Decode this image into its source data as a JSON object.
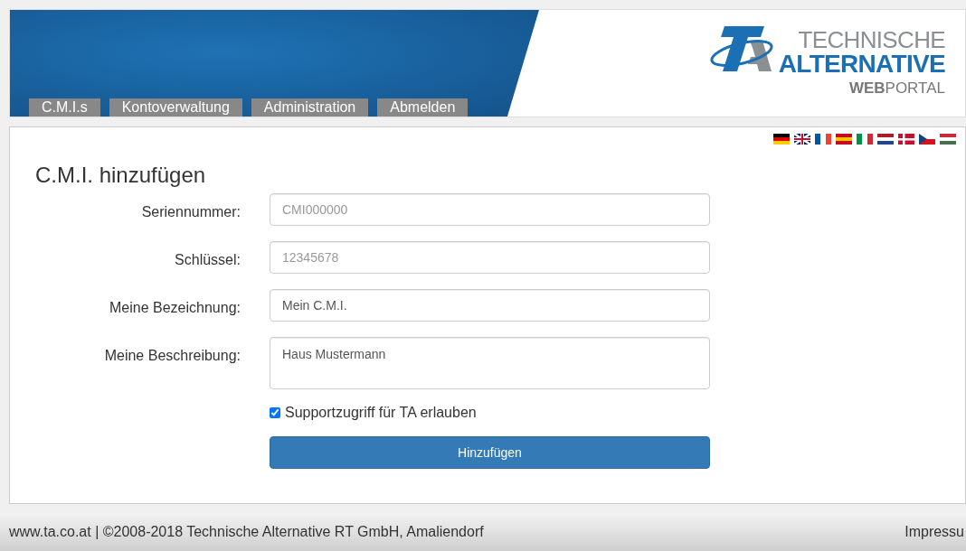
{
  "nav_tabs": [
    {
      "label": "C.M.I.s"
    },
    {
      "label": "Kontoverwaltung"
    },
    {
      "label": "Administration"
    },
    {
      "label": "Abmelden"
    }
  ],
  "logo": {
    "line_1": "TECHNISCHE",
    "line_2": "ALTERNATIVE",
    "line_3": "**WEB**PORTAL"
  },
  "heading": "C.M.I. hinzufügen",
  "fields": [
    {
      "kind": "input",
      "label": "Seriennummer:",
      "placeholder": "CMI000000"
    },
    {
      "kind": "input",
      "label": "Schlüssel:",
      "placeholder": "12345678"
    },
    {
      "kind": "input",
      "label": "Meine Bezeichnung:",
      "value": "Mein C.M.I."
    },
    {
      "kind": "textarea",
      "label": "Meine Beschreibung:",
      "value": "Haus Mustermann"
    }
  ],
  "support_checkbox": {
    "label": "Supportzugriff für TA erlauben",
    "checked": true
  },
  "submit_button": "Hinzufügen",
  "footer": {
    "copyright": "www.ta.co.at | ©2008-2018 Technische Alternative RT GmbH, Amaliendorf",
    "link": "Impressu"
  }
}
